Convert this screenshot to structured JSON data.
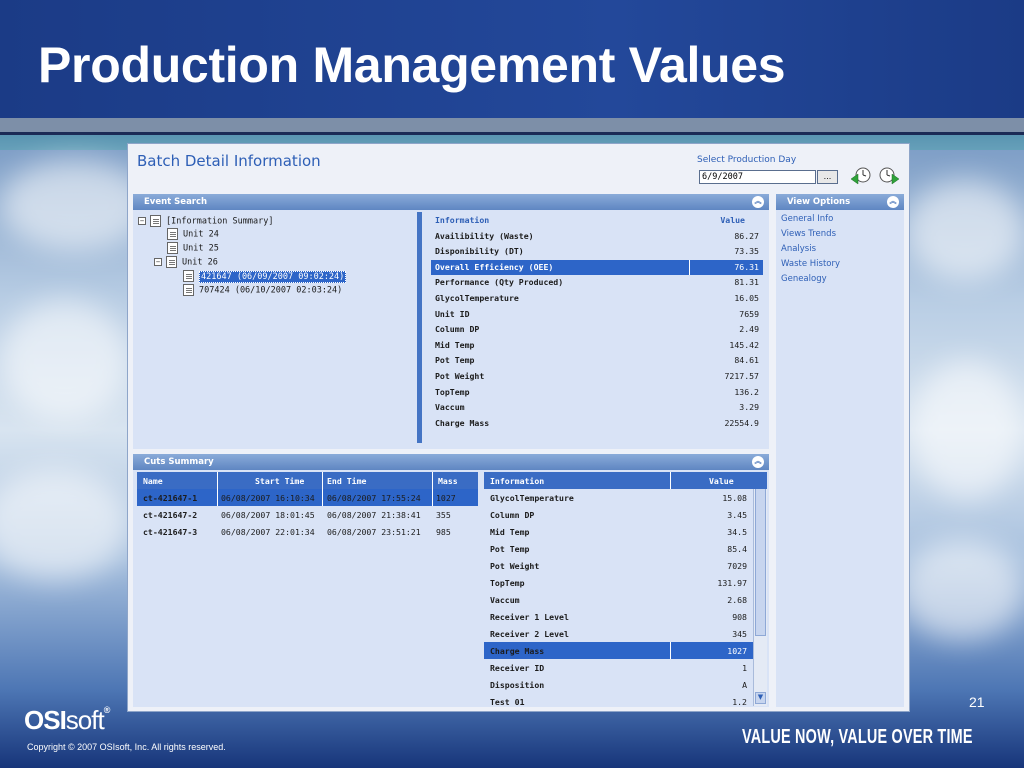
{
  "slide": {
    "title": "Production Management Values",
    "page_number": "21",
    "copyright": "Copyright © 2007 OSIsoft, Inc. All rights reserved.",
    "logo_bold": "OSI",
    "logo_light": "soft",
    "logo_mark": "®",
    "tagline": "VALUE NOW, VALUE OVER TIME"
  },
  "app": {
    "title": "Batch Detail Information",
    "day_label": "Select Production Day",
    "day_value": "6/9/2007",
    "day_button": "...",
    "prev_icon": "back-clock-icon",
    "next_icon": "forward-clock-icon"
  },
  "event_search": {
    "header": "Event Search",
    "root": "[Information Summary]",
    "units": [
      "Unit 24",
      "Unit 25",
      "Unit 26"
    ],
    "batches": [
      "421647 (06/09/2007 09:02:24)",
      "707424 (06/10/2007 02:03:24)"
    ]
  },
  "info": {
    "header_label": "Information",
    "header_value": "Value",
    "rows": [
      {
        "label": "Availibility (Waste)",
        "value": "86.27"
      },
      {
        "label": "Disponibility (DT)",
        "value": "73.35"
      },
      {
        "label": "Overall Efficiency (OEE)",
        "value": "76.31"
      },
      {
        "label": "Performance (Qty Produced)",
        "value": "81.31"
      },
      {
        "label": "GlycolTemperature",
        "value": "16.05"
      },
      {
        "label": "Unit ID",
        "value": "7659"
      },
      {
        "label": "Column DP",
        "value": "2.49"
      },
      {
        "label": "Mid Temp",
        "value": "145.42"
      },
      {
        "label": "Pot Temp",
        "value": "84.61"
      },
      {
        "label": "Pot Weight",
        "value": "7217.57"
      },
      {
        "label": "TopTemp",
        "value": "136.2"
      },
      {
        "label": "Vaccum",
        "value": "3.29"
      },
      {
        "label": "Charge Mass",
        "value": "22554.9"
      }
    ]
  },
  "view_options": {
    "header": "View Options",
    "links": [
      "General Info",
      "Views Trends",
      "Analysis",
      "Waste History",
      "Genealogy"
    ]
  },
  "cuts": {
    "header": "Cuts Summary",
    "columns": [
      "Name",
      "Start Time",
      "End Time",
      "Mass"
    ],
    "rows": [
      {
        "name": "ct-421647-1",
        "start": "06/08/2007 16:10:34",
        "end": "06/08/2007 17:55:24",
        "mass": "1027"
      },
      {
        "name": "ct-421647-2",
        "start": "06/08/2007 18:01:45",
        "end": "06/08/2007 21:38:41",
        "mass": "355"
      },
      {
        "name": "ct-421647-3",
        "start": "06/08/2007 22:01:34",
        "end": "06/08/2007 23:51:21",
        "mass": "985"
      }
    ]
  },
  "cut_info": {
    "header_label": "Information",
    "header_value": "Value",
    "rows": [
      {
        "label": "GlycolTemperature",
        "value": "15.08"
      },
      {
        "label": "Column DP",
        "value": "3.45"
      },
      {
        "label": "Mid Temp",
        "value": "34.5"
      },
      {
        "label": "Pot Temp",
        "value": "85.4"
      },
      {
        "label": "Pot Weight",
        "value": "7029"
      },
      {
        "label": "TopTemp",
        "value": "131.97"
      },
      {
        "label": "Vaccum",
        "value": "2.68"
      },
      {
        "label": "Receiver 1 Level",
        "value": "908"
      },
      {
        "label": "Receiver 2 Level",
        "value": "345"
      },
      {
        "label": "Charge Mass",
        "value": "1027"
      },
      {
        "label": "Receiver ID",
        "value": "1"
      },
      {
        "label": "Disposition",
        "value": "A"
      },
      {
        "label": "Test 01",
        "value": "1.2"
      }
    ]
  }
}
